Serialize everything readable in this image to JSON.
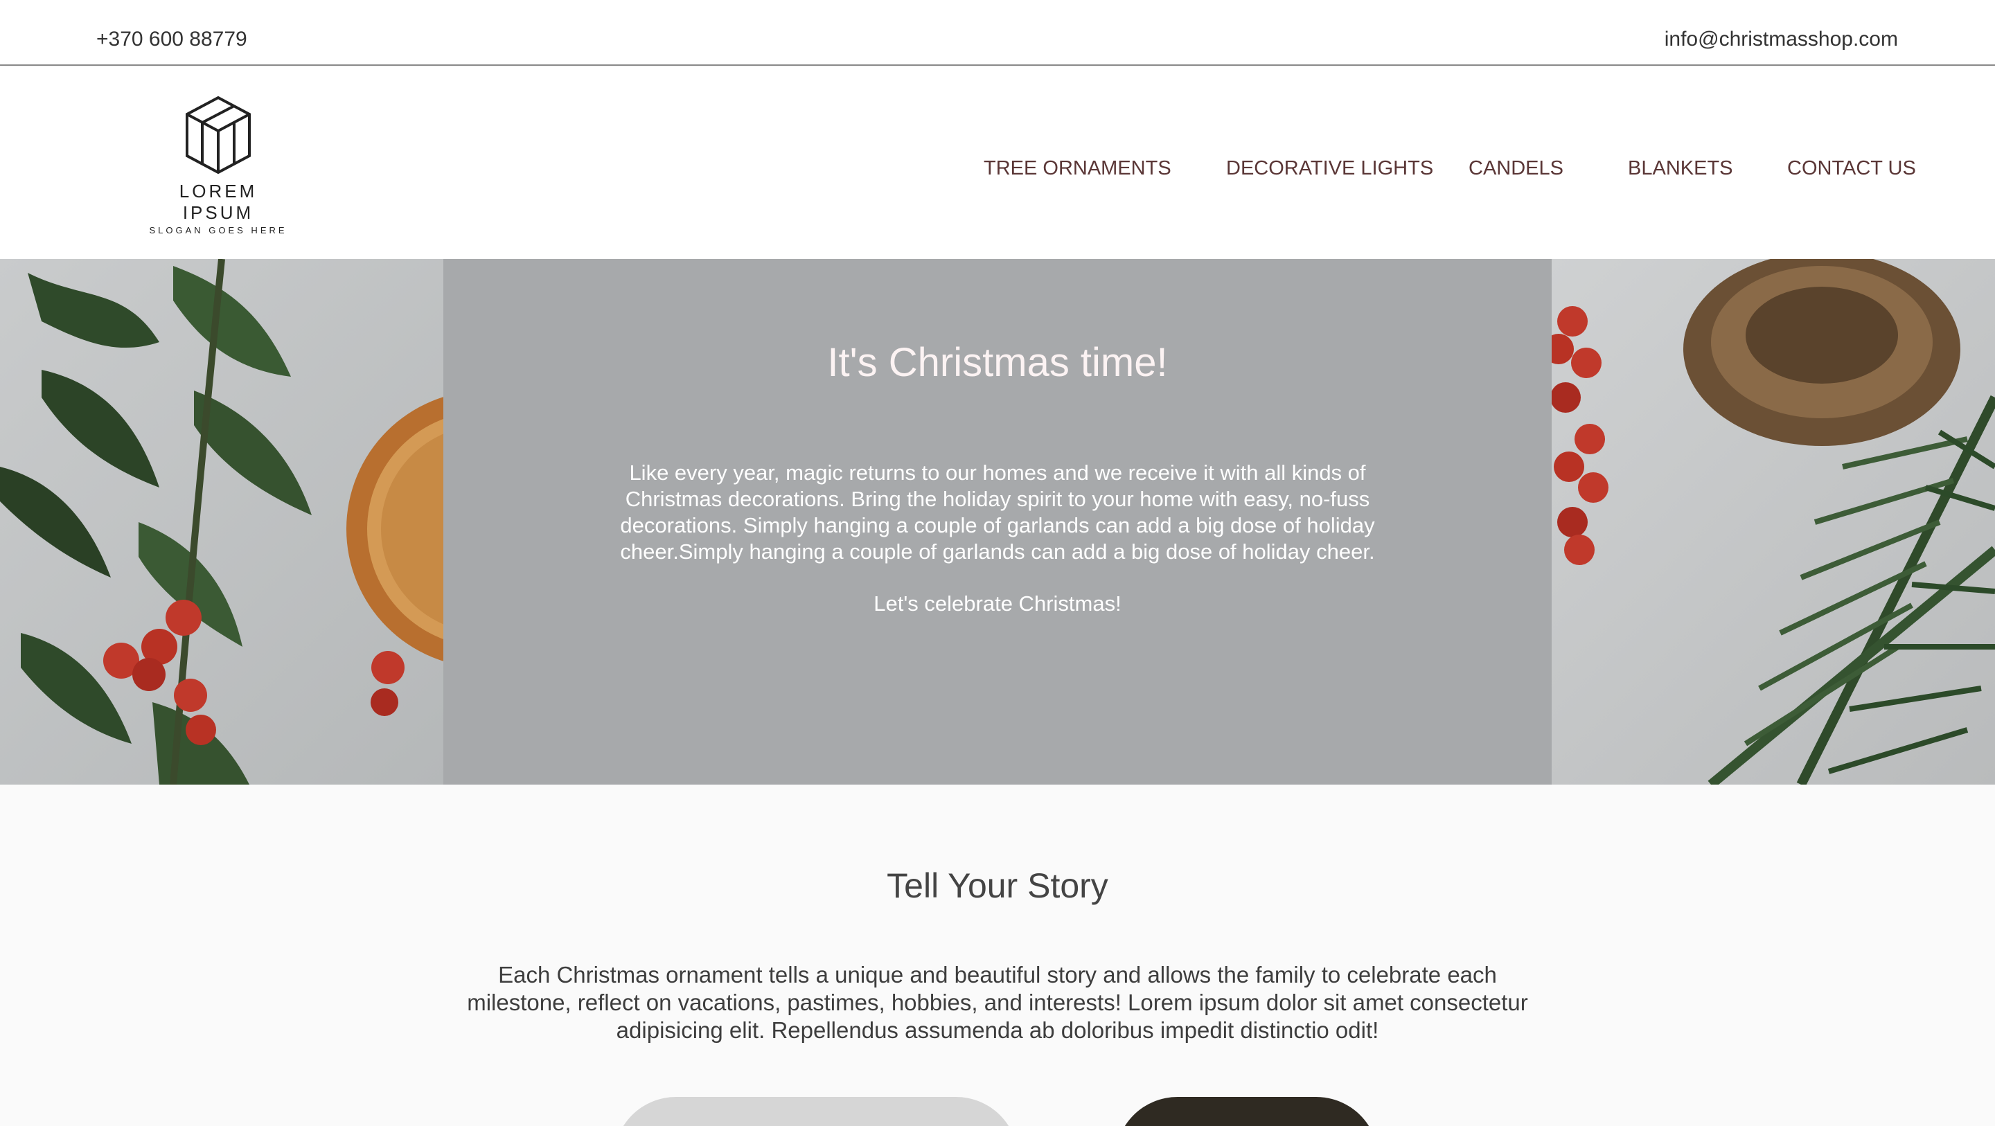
{
  "topbar": {
    "phone": "+370 600 88779",
    "email": "info@christmasshop.com"
  },
  "logo": {
    "name": "LOREM IPSUM",
    "slogan": "SLOGAN GOES HERE"
  },
  "nav": {
    "items": [
      {
        "label": "TREE ORNAMENTS"
      },
      {
        "label": "DECORATIVE LIGHTS"
      },
      {
        "label": "CANDELS"
      },
      {
        "label": "BLANKETS"
      },
      {
        "label": "CONTACT US"
      }
    ]
  },
  "hero": {
    "title": "It's Christmas time!",
    "body": "Like every year, magic returns to our homes and we receive it with all kinds of Christmas decorations. Bring the holiday spirit to your home with easy, no-fuss decorations. Simply hanging a couple of garlands can add a big dose of holiday cheer.Simply hanging a couple of garlands can add a big dose of holiday cheer.",
    "cta": "Let's celebrate Christmas!"
  },
  "story": {
    "title": "Tell Your Story",
    "body": "Each Christmas ornament tells a unique and beautiful story and allows the family to celebrate each milestone, reflect on vacations, pastimes, hobbies, and interests! Lorem ipsum dolor sit amet consectetur adipisicing elit. Repellendus assumenda ab doloribus impedit distinctio odit!"
  },
  "colors": {
    "nav_text": "#5a3636",
    "hero_panel": "#a7a9ab",
    "berry_red": "#c0392b",
    "holly_green": "#2f4a2a"
  }
}
